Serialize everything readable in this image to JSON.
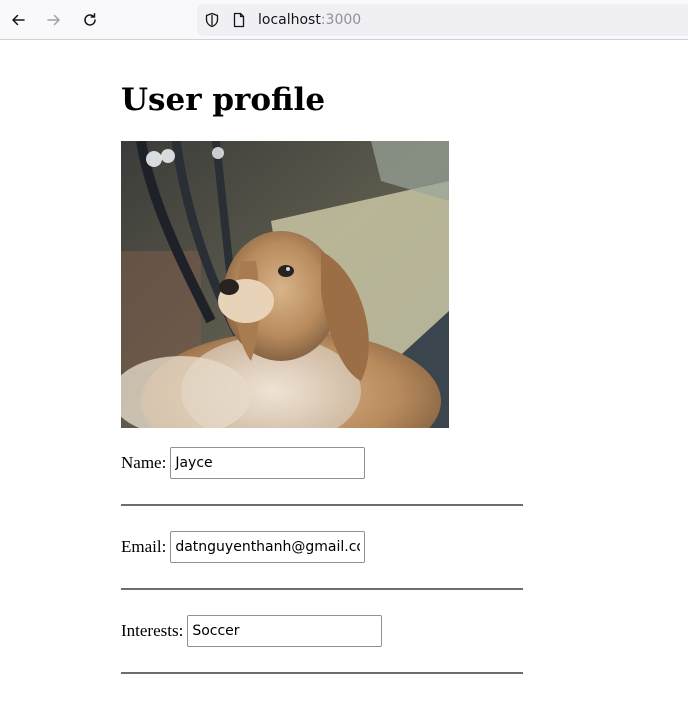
{
  "browser": {
    "url_host": "localhost",
    "url_port": ":3000"
  },
  "page": {
    "title": "User profile",
    "photo_alt": "dog"
  },
  "form": {
    "name_label": "Name:",
    "name_value": "Jayce",
    "email_label": "Email:",
    "email_value": "datnguyenthanh@gmail.com",
    "interests_label": "Interests:",
    "interests_value": "Soccer"
  },
  "icons": {
    "back": "arrow-left-icon",
    "forward": "arrow-right-icon",
    "reload": "reload-icon",
    "shield": "shield-icon",
    "page": "page-icon"
  }
}
